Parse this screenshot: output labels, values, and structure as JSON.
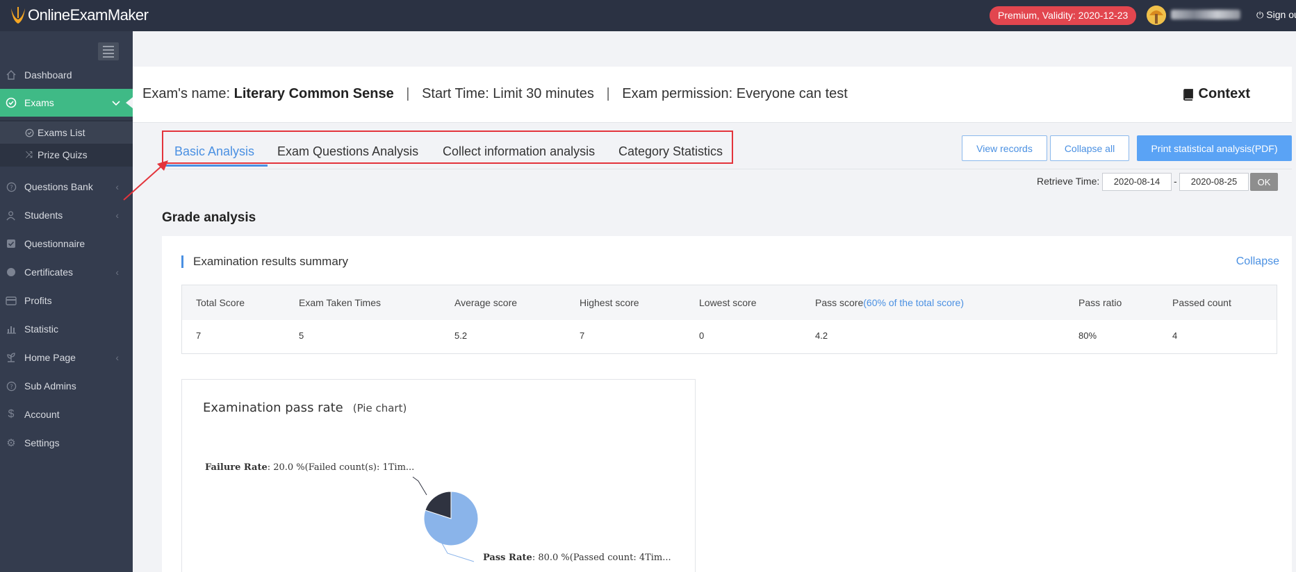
{
  "app": {
    "logo_text": "OnlineExamMaker",
    "premium_badge": "Premium, Validity: 2020-12-23",
    "sign_out": "Sign out",
    "accent_green": "#3fba86",
    "accent_blue": "#4a90e2"
  },
  "sidebar": {
    "items": [
      {
        "label": "Dashboard",
        "icon": "home-icon"
      },
      {
        "label": "Exams",
        "icon": "check-circle-icon",
        "active": true
      },
      {
        "label": "Questions Bank",
        "icon": "question-circle-icon"
      },
      {
        "label": "Students",
        "icon": "users-icon"
      },
      {
        "label": "Questionnaire",
        "icon": "checkbox-icon"
      },
      {
        "label": "Certificates",
        "icon": "badge-icon"
      },
      {
        "label": "Profits",
        "icon": "card-icon"
      },
      {
        "label": "Statistic",
        "icon": "bar-chart-icon"
      },
      {
        "label": "Home Page",
        "icon": "plant-icon"
      },
      {
        "label": "Sub Admins",
        "icon": "question-circle-icon"
      },
      {
        "label": "Account",
        "icon": "dollar-icon"
      },
      {
        "label": "Settings",
        "icon": "gear-icon"
      }
    ],
    "sub_items": [
      {
        "label": "Exams List",
        "icon": "check-circle-icon"
      },
      {
        "label": "Prize Quizs",
        "icon": "shuffle-icon"
      }
    ]
  },
  "exam": {
    "name_label": "Exam's name:",
    "name": "Literary Common Sense",
    "start_time": "Start Time: Limit 30 minutes",
    "permission": "Exam permission: Everyone can test",
    "separator": "|",
    "context_label": "Context"
  },
  "tabs": [
    {
      "label": "Basic Analysis",
      "active": true
    },
    {
      "label": "Exam Questions Analysis"
    },
    {
      "label": "Collect information analysis"
    },
    {
      "label": "Category Statistics"
    }
  ],
  "toolbar": {
    "view_records": "View records",
    "collapse_all": "Collapse all",
    "print_pdf": "Print statistical analysis(PDF)",
    "retrieve_label": "Retrieve Time:",
    "date_from": "2020-08-14",
    "date_dash": "-",
    "date_to": "2020-08-25",
    "ok": "OK"
  },
  "grade_analysis": {
    "title": "Grade analysis",
    "summary_title": "Examination results summary",
    "collapse": "Collapse",
    "headers": {
      "total_score": "Total Score",
      "exam_taken_times": "Exam Taken Times",
      "average_score": "Average score",
      "highest_score": "Highest score",
      "lowest_score": "Lowest score",
      "pass_score": "Pass score",
      "pass_score_note": "(60% of the total score)",
      "pass_ratio": "Pass ratio",
      "passed_count": "Passed count"
    },
    "values": {
      "total_score": "7",
      "exam_taken_times": "5",
      "average_score": "5.2",
      "highest_score": "7",
      "lowest_score": "0",
      "pass_score": "4.2",
      "pass_ratio": "80%",
      "passed_count": "4"
    }
  },
  "chart_data": {
    "type": "pie",
    "title": "Examination pass rate",
    "subtitle": "(Pie chart)",
    "slices": [
      {
        "name": "Pass Rate",
        "value": 80.0,
        "label_text": ": 80.0 %(Passed count: 4Tim...",
        "color": "#8ab4ea"
      },
      {
        "name": "Failure Rate",
        "value": 20.0,
        "label_text": ": 20.0 %(Failed count(s): 1Tim...",
        "color": "#2f3340"
      }
    ]
  }
}
